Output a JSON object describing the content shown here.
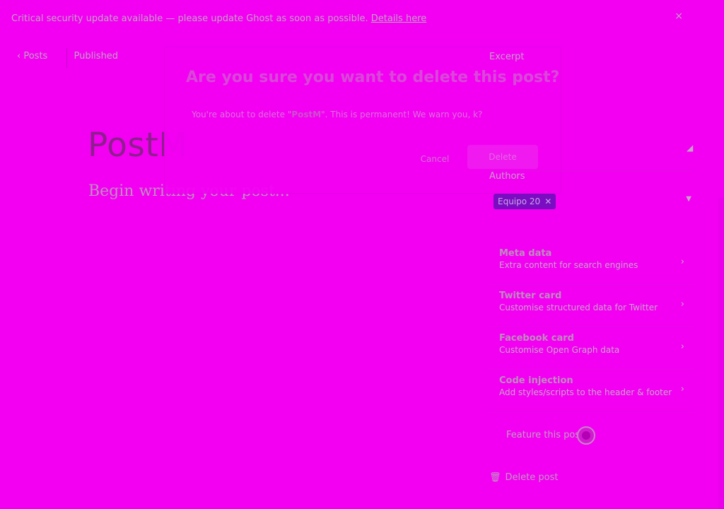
{
  "banner": {
    "text": "Critical security update available — please update Ghost as soon as possible.",
    "link": "Details here",
    "close_icon": "×"
  },
  "nav": {
    "back_label": "Posts",
    "status": "Published"
  },
  "editor": {
    "title": "PostM",
    "body_placeholder": "Begin writing your post..."
  },
  "modal": {
    "title": "Are you sure you want to delete this post?",
    "message_prefix": "You're about to delete \"",
    "post_name": "PostM",
    "message_suffix": "\". This is permanent! We warn you, k?",
    "cancel_label": "Cancel",
    "delete_label": "Delete"
  },
  "panel": {
    "excerpt_label": "Excerpt",
    "authors_label": "Authors",
    "author": "Equipo 20",
    "settings": [
      {
        "title": "Meta data",
        "desc": "Extra content for search engines"
      },
      {
        "title": "Twitter card",
        "desc": "Customise structured data for Twitter"
      },
      {
        "title": "Facebook card",
        "desc": "Customise Open Graph data"
      },
      {
        "title": "Code injection",
        "desc": "Add styles/scripts to the header & footer"
      }
    ],
    "feature_label": "Feature this post",
    "delete_label": "Delete post"
  },
  "colors": {
    "background": "#f300f3",
    "author_chip": "#7a0dc2"
  }
}
